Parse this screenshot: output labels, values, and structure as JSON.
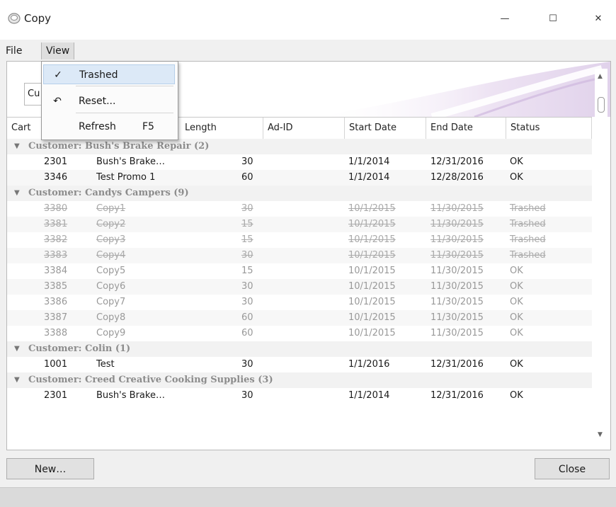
{
  "window": {
    "title": "Copy",
    "minimize_glyph": "—",
    "maximize_glyph": "☐",
    "close_glyph": "✕"
  },
  "menu": {
    "file": "File",
    "view": "View"
  },
  "view_menu": [
    {
      "label": "Trashed",
      "icon": "check-icon",
      "glyph": "✓",
      "shortcut": "",
      "highlighted": true
    },
    {
      "label": "Reset...",
      "icon": "undo-icon",
      "glyph": "↶",
      "shortcut": ""
    },
    {
      "label": "Refresh",
      "icon": "",
      "glyph": "",
      "shortcut": "F5"
    }
  ],
  "search": {
    "value": "Cu"
  },
  "columns": [
    "Cart",
    "Length",
    "Ad-ID",
    "Start Date",
    "End Date",
    "Status"
  ],
  "groups": [
    {
      "label": "Customer: Bush's Brake Repair (2)",
      "rows": [
        {
          "cart": "2301",
          "name": "Bush's Brake…",
          "length": "30",
          "adid": "",
          "start": "1/1/2014",
          "end": "12/31/2016",
          "status": "OK",
          "state": "normal"
        },
        {
          "cart": "3346",
          "name": "Test Promo 1",
          "length": "60",
          "adid": "",
          "start": "1/1/2014",
          "end": "12/28/2016",
          "status": "OK",
          "state": "normal"
        }
      ]
    },
    {
      "label": "Customer: Candys Campers (9)",
      "rows": [
        {
          "cart": "3380",
          "name": "Copy1",
          "length": "30",
          "adid": "",
          "start": "10/1/2015",
          "end": "11/30/2015",
          "status": "Trashed",
          "state": "trashed"
        },
        {
          "cart": "3381",
          "name": "Copy2",
          "length": "15",
          "adid": "",
          "start": "10/1/2015",
          "end": "11/30/2015",
          "status": "Trashed",
          "state": "trashed"
        },
        {
          "cart": "3382",
          "name": "Copy3",
          "length": "15",
          "adid": "",
          "start": "10/1/2015",
          "end": "11/30/2015",
          "status": "Trashed",
          "state": "trashed"
        },
        {
          "cart": "3383",
          "name": "Copy4",
          "length": "30",
          "adid": "",
          "start": "10/1/2015",
          "end": "11/30/2015",
          "status": "Trashed",
          "state": "trashed"
        },
        {
          "cart": "3384",
          "name": "Copy5",
          "length": "15",
          "adid": "",
          "start": "10/1/2015",
          "end": "11/30/2015",
          "status": "OK",
          "state": "gray"
        },
        {
          "cart": "3385",
          "name": "Copy6",
          "length": "30",
          "adid": "",
          "start": "10/1/2015",
          "end": "11/30/2015",
          "status": "OK",
          "state": "gray"
        },
        {
          "cart": "3386",
          "name": "Copy7",
          "length": "30",
          "adid": "",
          "start": "10/1/2015",
          "end": "11/30/2015",
          "status": "OK",
          "state": "gray"
        },
        {
          "cart": "3387",
          "name": "Copy8",
          "length": "60",
          "adid": "",
          "start": "10/1/2015",
          "end": "11/30/2015",
          "status": "OK",
          "state": "gray"
        },
        {
          "cart": "3388",
          "name": "Copy9",
          "length": "60",
          "adid": "",
          "start": "10/1/2015",
          "end": "11/30/2015",
          "status": "OK",
          "state": "gray"
        }
      ]
    },
    {
      "label": "Customer: Colin (1)",
      "rows": [
        {
          "cart": "1001",
          "name": "Test",
          "length": "30",
          "adid": "",
          "start": "1/1/2016",
          "end": "12/31/2016",
          "status": "OK",
          "state": "normal"
        }
      ]
    },
    {
      "label": "Customer: Creed Creative Cooking Supplies (3)",
      "rows": [
        {
          "cart": "2301",
          "name": "Bush's Brake…",
          "length": "30",
          "adid": "",
          "start": "1/1/2014",
          "end": "12/31/2016",
          "status": "OK",
          "state": "normal"
        }
      ]
    }
  ],
  "buttons": {
    "new": "New…",
    "close": "Close"
  },
  "colors": {
    "highlight": "#dce9f7",
    "trashed_text": "#aaaaaa",
    "group_text": "#8c8c8c"
  }
}
